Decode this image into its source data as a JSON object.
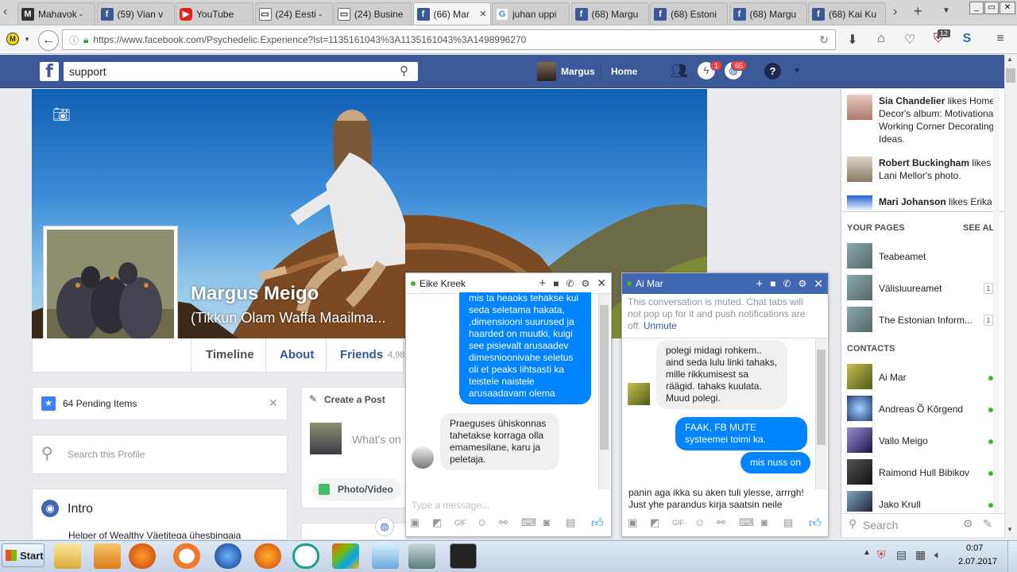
{
  "browser": {
    "tabs": [
      {
        "label": "Mahavok -",
        "icon": "mahavok-icon",
        "active": false
      },
      {
        "label": "(59) Vian v",
        "icon": "facebook-icon",
        "active": false
      },
      {
        "label": "YouTube",
        "icon": "youtube-icon",
        "active": false
      },
      {
        "label": "(24) Eesti -",
        "icon": "document-icon",
        "active": false
      },
      {
        "label": "(24) Busine",
        "icon": "document-icon",
        "active": false
      },
      {
        "label": "(66) Mar",
        "icon": "facebook-icon",
        "active": true
      },
      {
        "label": "juhan uppi",
        "icon": "google-icon",
        "active": false
      },
      {
        "label": "(68) Margu",
        "icon": "facebook-icon",
        "active": false
      },
      {
        "label": "(68) Estoni",
        "icon": "facebook-icon",
        "active": false
      },
      {
        "label": "(68) Margu",
        "icon": "facebook-icon",
        "active": false
      },
      {
        "label": "(68) Kai Ku",
        "icon": "facebook-icon",
        "active": false
      }
    ],
    "url": "https://www.facebook.com/Psychedelic.Experience?lst=1135161043%3A1135161043%3A1498996270",
    "addon_badge": "12"
  },
  "fb_header": {
    "search_value": "support",
    "user_name": "Margus",
    "home_label": "Home",
    "messages_badge": "1",
    "notifications_badge": "65"
  },
  "profile": {
    "name": "Margus Meigo",
    "subtitle": "(Tikkun Olam Waffa Maailma...",
    "tabs": {
      "timeline": "Timeline",
      "about": "About",
      "friends": "Friends",
      "friends_count": "4,98"
    }
  },
  "left": {
    "pending_items": "64 Pending Items",
    "search_placeholder": "Search this Profile",
    "intro_title": "Intro",
    "intro_line": "Helper of Wealthy Väetitega ühesbingaja"
  },
  "composer": {
    "create_post": "Create a Post",
    "placeholder": "What's on",
    "photo_video": "Photo/Video"
  },
  "ticker": [
    {
      "name": "Sia Chandelier",
      "text": " likes Home Decor's album: Motivational Working Corner Decorating Ideas."
    },
    {
      "name": "Robert Buckingham",
      "text": " likes Lani Mellor's photo."
    },
    {
      "name": "Mari Johanson",
      "text": " likes Erika"
    }
  ],
  "your_pages": {
    "title": "YOUR PAGES",
    "see_all": "SEE ALL",
    "items": [
      {
        "name": "Teabeamet",
        "count": ""
      },
      {
        "name": "Välisluureamet",
        "count": "1"
      },
      {
        "name": "The Estonian Inform...",
        "count": "1"
      }
    ]
  },
  "contacts": {
    "title": "CONTACTS",
    "items": [
      "Ai Mar",
      "Andreas Õ Kõrgend",
      "Vallo Meigo",
      "Raimond Hull Bibikov",
      "Jako Krull"
    ],
    "search_placeholder": "Search"
  },
  "chat1": {
    "name": "Eike Kreek",
    "msg_out": "mis ta heaoks tehakse kui seda seletama hakata, ,dimensiooni suurused ja haarded on muutki, kuigi see pisievalt arusaadev dimesnioonivahe seletus oli et peaks lihtsasti ka teistele naistele arusaadavam olema",
    "msg_in": "Praeguses ühiskonnas tahetakse korraga olla emamesilane, karu ja peletaja.",
    "input_placeholder": "Type a message..."
  },
  "chat2": {
    "name": "Ai Mar",
    "muted_notice": "This conversation is muted. Chat tabs will not pop up for it and push notifications are off.",
    "unmute": "Unmute",
    "msg_in": "polegi midagi rohkem.. aind seda lulu linki tahaks, mille rikkumisest sa räägid. tahaks kuulata. Muud polegi.",
    "msg_out1": "FAAK, FB MUTE systeemei toimi ka.",
    "msg_out2": "mis nuss on",
    "draft": "panin aga ikka su aken tuli ylesse, arrrgh! Just yhe parandus kirja saatsin neile"
  },
  "taskbar": {
    "start": "Start",
    "time": "0:07",
    "date": "2.07.2017"
  },
  "colors": {
    "fb_blue": "#3b5998",
    "messenger_blue": "#0084ff",
    "online_green": "#42b72a"
  }
}
